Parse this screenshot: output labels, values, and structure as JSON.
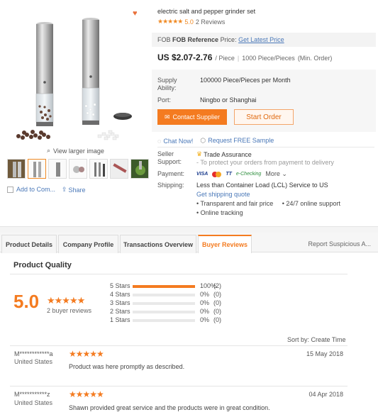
{
  "product": {
    "title": "electric salt and pepper grinder set",
    "rating": "5.0",
    "reviews": "2 Reviews",
    "view_larger": "View larger image",
    "add_compare": "Add to Com...",
    "share": "Share"
  },
  "fob": {
    "label": "FOB Reference",
    "price_word": "Price:",
    "link": "Get Latest Price"
  },
  "price": {
    "value": "US $2.07-2.76",
    "unit": "/ Piece",
    "moq": "1000 Piece/Pieces",
    "moq_note": "(Min. Order)"
  },
  "supply": {
    "ability_label": "Supply Ability:",
    "ability_value": "100000 Piece/Pieces per Month",
    "port_label": "Port:",
    "port_value": "Ningbo or Shanghai"
  },
  "actions": {
    "contact": "Contact Supplier",
    "order": "Start Order",
    "chat": "Chat Now!",
    "sample": "Request FREE Sample"
  },
  "seller": {
    "support_label": "Seller Support:",
    "trade": "Trade Assurance",
    "trade_sub": "- To protect your orders from payment to delivery",
    "payment_label": "Payment:",
    "pay_visa": "VISA",
    "pay_tt": "TT",
    "pay_echeck": "e-Checking",
    "pay_more": "More",
    "shipping_label": "Shipping:",
    "shipping_value": "Less than Container Load (LCL) Service to US",
    "shipping_link": "Get shipping quote",
    "bullets": [
      "Transparent and fair price",
      "24/7 online support",
      "Online tracking"
    ]
  },
  "tabs": [
    {
      "label": "Product Details"
    },
    {
      "label": "Company Profile"
    },
    {
      "label": "Transactions Overview"
    },
    {
      "label": "Buyer Reviews"
    }
  ],
  "report": "Report Suspicious A...",
  "quality": {
    "title": "Product Quality",
    "score": "5.0",
    "buyer_reviews": "2 buyer reviews",
    "distribution": [
      {
        "label": "5 Stars",
        "pct": "100%",
        "count": "(2)",
        "fraction": 1.0
      },
      {
        "label": "4 Stars",
        "pct": "0%",
        "count": "(0)",
        "fraction": 0
      },
      {
        "label": "3 Stars",
        "pct": "0%",
        "count": "(0)",
        "fraction": 0
      },
      {
        "label": "2 Stars",
        "pct": "0%",
        "count": "(0)",
        "fraction": 0
      },
      {
        "label": "1 Stars",
        "pct": "0%",
        "count": "(0)",
        "fraction": 0
      }
    ]
  },
  "sort": "Sort by: Create Time",
  "reviews": [
    {
      "name": "M************a",
      "country": "United States",
      "date": "15 May 2018",
      "text": "Product was here promptly as described.",
      "stars": 5
    },
    {
      "name": "M***********z",
      "country": "United States",
      "date": "04 Apr 2018",
      "text": "Shawn provided great service and the products were in great condition.",
      "stars": 5
    }
  ],
  "colors": {
    "accent": "#f47b20",
    "link": "#4a78b8"
  }
}
